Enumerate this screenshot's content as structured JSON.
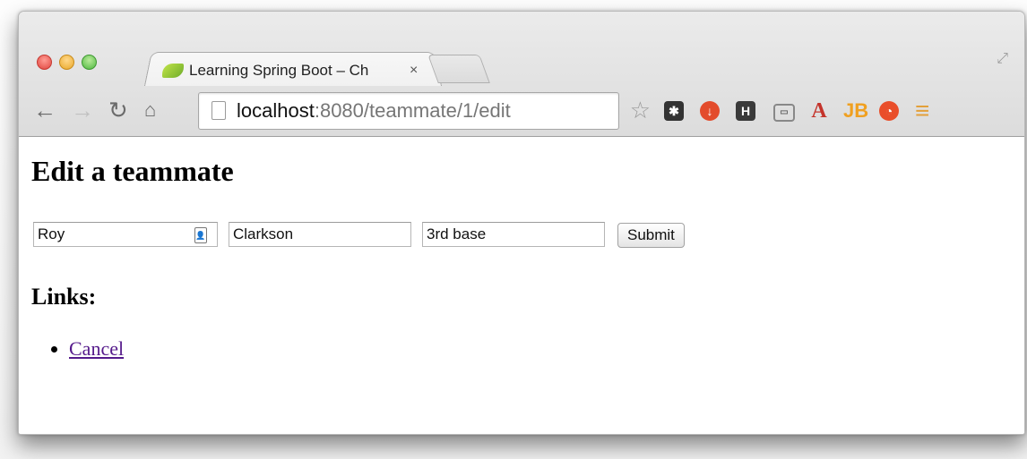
{
  "browser": {
    "tab_title": "Learning Spring Boot – Ch",
    "tab_close": "×",
    "url_host": "localhost",
    "url_rest": ":8080/teammate/1/edit"
  },
  "icons": {
    "back": "back-arrow-icon",
    "forward": "forward-arrow-icon",
    "reload": "reload-icon",
    "home": "home-icon",
    "star": "bookmark-star-icon",
    "menu": "menu-icon"
  },
  "page": {
    "title": "Edit a teammate",
    "form": {
      "first_name": "Roy",
      "last_name": "Clarkson",
      "position": "3rd base",
      "submit_label": "Submit"
    },
    "links_heading": "Links:",
    "links": [
      {
        "label": "Cancel"
      }
    ]
  },
  "colors": {
    "link_visited": "#551a8b",
    "menu_accent": "#e3a03a"
  }
}
